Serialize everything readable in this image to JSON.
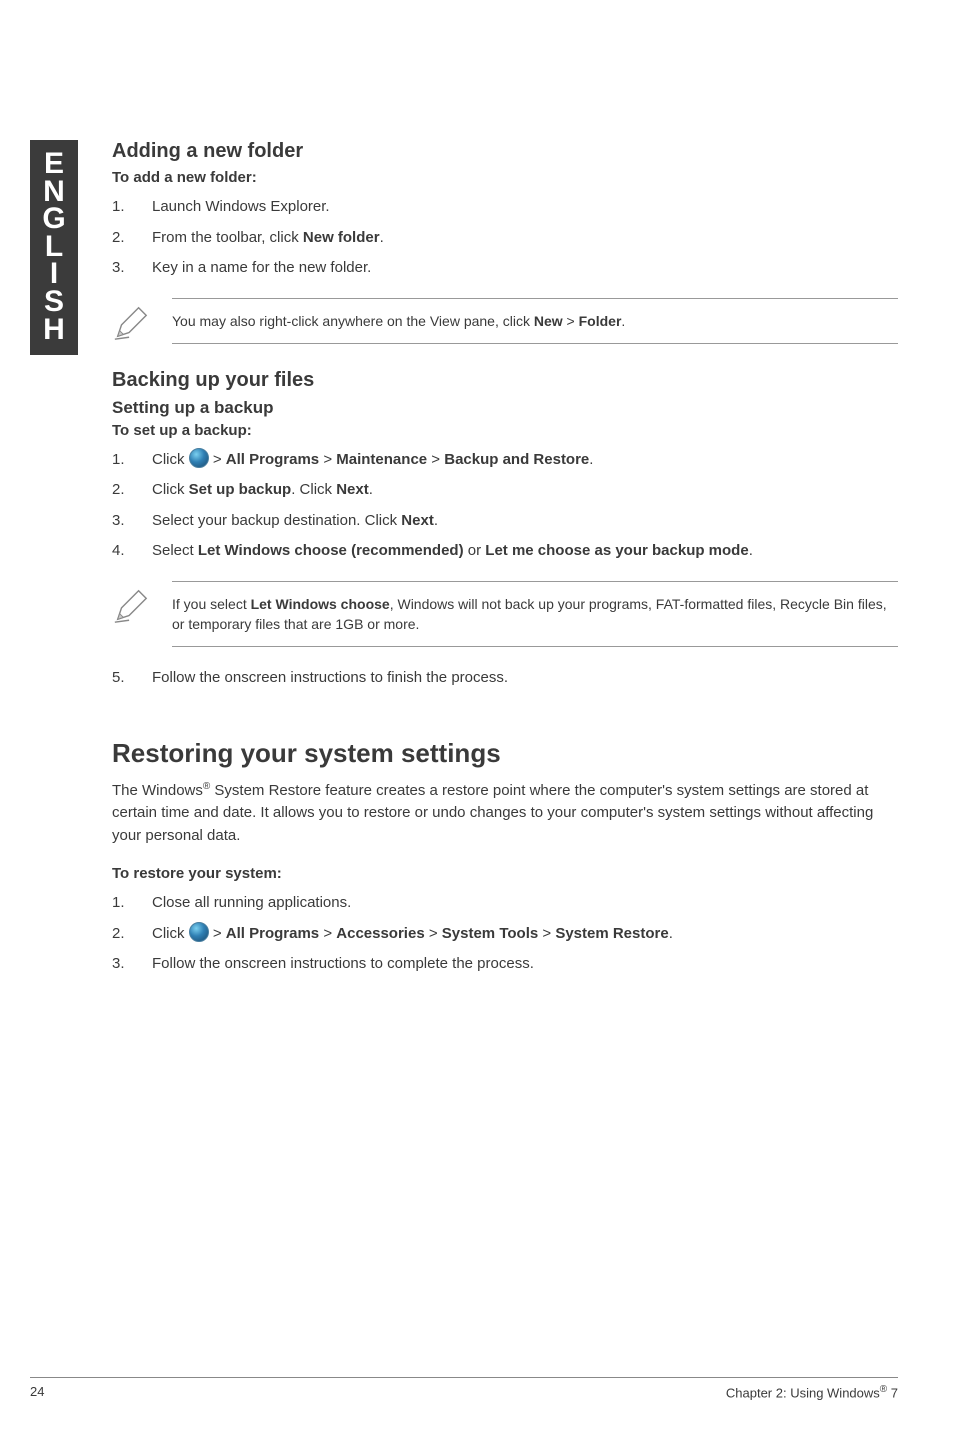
{
  "sidebar": {
    "label": "ENGLISH"
  },
  "s1": {
    "heading": "Adding a new folder",
    "sub": "To add a new folder:",
    "step1": "Launch Windows Explorer.",
    "step2_a": "From the toolbar, click ",
    "step2_b": "New folder",
    "step2_c": ".",
    "step3": "Key in a name for the new folder."
  },
  "note1_a": "You may also right-click anywhere on the View pane, click ",
  "note1_b": "New",
  "note1_c": " > ",
  "note1_d": "Folder",
  "note1_e": ".",
  "s2": {
    "heading": "Backing up your files",
    "subhead": "Setting up a backup",
    "sub": "To set up a backup:",
    "step1_a": "Click ",
    "step1_b": " > ",
    "step1_c": "All Programs",
    "step1_d": " > ",
    "step1_e": "Maintenance",
    "step1_f": " > ",
    "step1_g": "Backup and Restore",
    "step1_h": ".",
    "step2_a": "Click ",
    "step2_b": "Set up backup",
    "step2_c": ". Click ",
    "step2_d": "Next",
    "step2_e": ".",
    "step3_a": "Select your backup destination. Click ",
    "step3_b": "Next",
    "step3_c": ".",
    "step4_a": "Select ",
    "step4_b": "Let Windows choose (recommended)",
    "step4_c": " or ",
    "step4_d": "Let me choose as your backup mode",
    "step4_e": "."
  },
  "note2_a": "If you select ",
  "note2_b": "Let Windows choose",
  "note2_c": ", Windows will not back up your programs, FAT-formatted files, Recycle Bin files, or temporary files that are 1GB or more.",
  "s2_step5": "Follow the onscreen instructions to finish the process.",
  "s3": {
    "heading": "Restoring your system settings",
    "para_a": "The Windows",
    "para_b": " System Restore feature creates a restore point where the computer's system settings are stored at certain time and date. It allows you to restore or undo changes to your computer's system settings without affecting your personal data.",
    "sub": "To restore your system:",
    "step1": "Close all running applications.",
    "step2_a": "Click ",
    "step2_b": " > ",
    "step2_c": "All Programs",
    "step2_d": " > ",
    "step2_e": "Accessories",
    "step2_f": " > ",
    "step2_g": "System Tools",
    "step2_h": " > ",
    "step2_i": "System Restore",
    "step2_j": ".",
    "step3": "Follow the onscreen instructions to complete the process."
  },
  "footer": {
    "page": "24",
    "chapter_a": "Chapter 2: Using Windows",
    "chapter_b": " 7"
  }
}
